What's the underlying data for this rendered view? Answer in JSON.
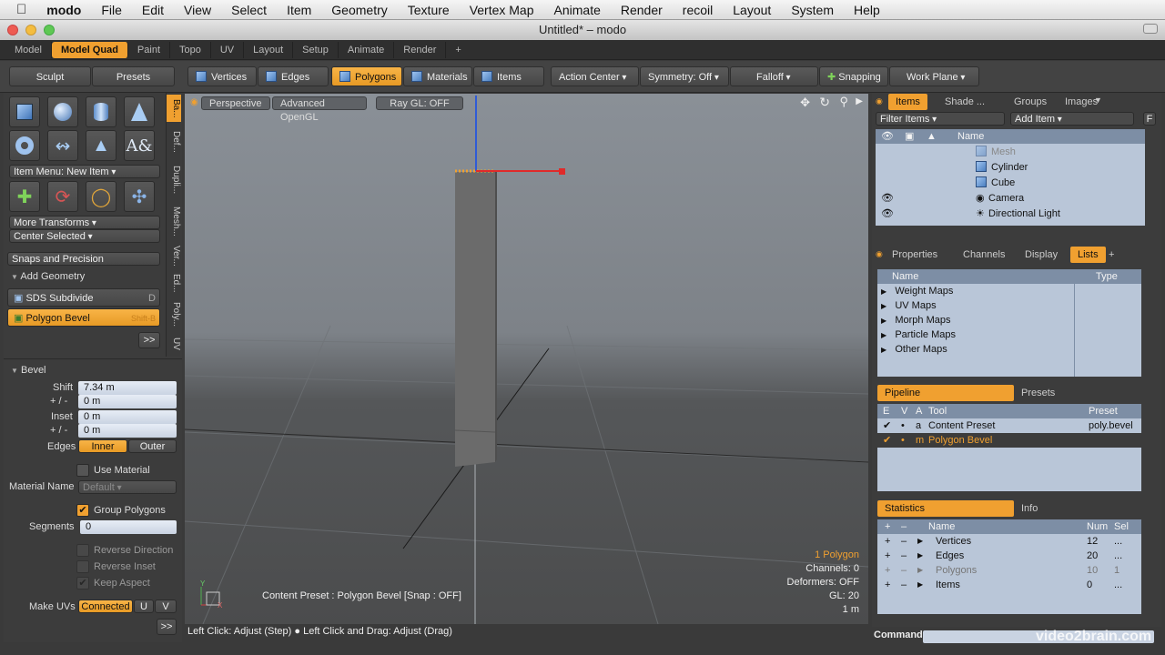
{
  "menubar": {
    "apple": "",
    "app": "modo",
    "items": [
      "File",
      "Edit",
      "View",
      "Select",
      "Item",
      "Geometry",
      "Texture",
      "Vertex Map",
      "Animate",
      "Render",
      "recoil",
      "Layout",
      "System",
      "Help"
    ]
  },
  "window": {
    "title": "Untitled* – modo"
  },
  "layout_tabs": [
    "Model",
    "Model Quad",
    "Paint",
    "Topo",
    "UV",
    "Layout",
    "Setup",
    "Animate",
    "Render",
    "+"
  ],
  "toolbar": {
    "sculpt": "Sculpt",
    "presets": "Presets",
    "vertices": "Vertices",
    "edges": "Edges",
    "polygons": "Polygons",
    "materials": "Materials",
    "items": "Items",
    "action_center": "Action Center",
    "symmetry": "Symmetry: Off",
    "falloff": "Falloff",
    "snapping": "Snapping",
    "work_plane": "Work Plane"
  },
  "left": {
    "item_menu": "Item Menu: New Item",
    "more_transforms": "More Transforms",
    "center_selected": "Center Selected",
    "snaps": "Snaps and Precision",
    "add_geometry": "Add Geometry",
    "sds": "SDS Subdivide",
    "sds_key": "D",
    "polygon_bevel": "Polygon Bevel",
    "polygon_bevel_key": "Shift-B",
    "more": ">>",
    "vtabs": [
      "Ba...",
      "Def...",
      "Dupli...",
      "Mesh...",
      "Ver...",
      "Ed...",
      "Poly...",
      "UV"
    ],
    "bevel": {
      "title": "Bevel",
      "shift_label": "Shift",
      "shift_value": "7.34 m",
      "pm1_label": "+ / -",
      "pm1_value": "0 m",
      "inset_label": "Inset",
      "inset_value": "0 m",
      "pm2_label": "+ / -",
      "pm2_value": "0 m",
      "edges_label": "Edges",
      "inner": "Inner",
      "outer": "Outer",
      "use_material": "Use Material",
      "material_name_label": "Material Name",
      "material_name": "Default",
      "group_polygons": "Group Polygons",
      "segments_label": "Segments",
      "segments_value": "0",
      "reverse_direction": "Reverse Direction",
      "reverse_inset": "Reverse Inset",
      "keep_aspect": "Keep Aspect",
      "make_uvs_label": "Make UVs",
      "connected": "Connected",
      "u": "U",
      "v": "V",
      "more": ">>"
    }
  },
  "viewport": {
    "perspective": "Perspective",
    "opengl": "Advanced OpenGL",
    "raygl": "Ray GL: OFF",
    "preset_line": "Content Preset : Polygon Bevel  [Snap : OFF]",
    "info": [
      "1 Polygon",
      "Channels: 0",
      "Deformers: OFF",
      "GL: 20",
      "1 m"
    ],
    "axis_y": "Y",
    "axis_x": "X"
  },
  "status": {
    "text": "Left Click: Adjust (Step) ●  Left Click and Drag: Adjust (Drag)"
  },
  "right": {
    "tabs1": [
      "Items",
      "Shade ...",
      "Groups",
      "Images"
    ],
    "filter": "Filter Items",
    "add_item": "Add Item",
    "f": "F",
    "name_header": "Name",
    "items": [
      "Mesh",
      "Cylinder",
      "Cube",
      "Camera",
      "Directional Light"
    ],
    "tabs2": [
      "Properties",
      "Channels",
      "Display",
      "Lists",
      "+"
    ],
    "lists_header_name": "Name",
    "lists_header_type": "Type",
    "lists": [
      "Weight Maps",
      "UV Maps",
      "Morph Maps",
      "Particle Maps",
      "Other Maps"
    ],
    "pipeline_tab": "Pipeline",
    "presets_tab": "Presets",
    "pipe_headers": [
      "E",
      "V",
      "A",
      "Tool",
      "Preset"
    ],
    "pipe_rows": [
      {
        "e": "✔",
        "v": "•",
        "a": "a",
        "tool": "Content Preset",
        "preset": "poly.bevel"
      },
      {
        "e": "✔",
        "v": "•",
        "a": "m",
        "tool": "Polygon Bevel",
        "preset": ""
      }
    ],
    "stats_tab": "Statistics",
    "info_tab": "Info",
    "stats_headers": [
      "+",
      "–",
      "Name",
      "Num",
      "Sel"
    ],
    "stats": [
      {
        "name": "Vertices",
        "num": "12",
        "sel": "..."
      },
      {
        "name": "Edges",
        "num": "20",
        "sel": "..."
      },
      {
        "name": "Polygons",
        "num": "10",
        "sel": "1"
      },
      {
        "name": "Items",
        "num": "0",
        "sel": "..."
      }
    ],
    "command_label": "Command",
    "watermark": "video2brain.com"
  }
}
